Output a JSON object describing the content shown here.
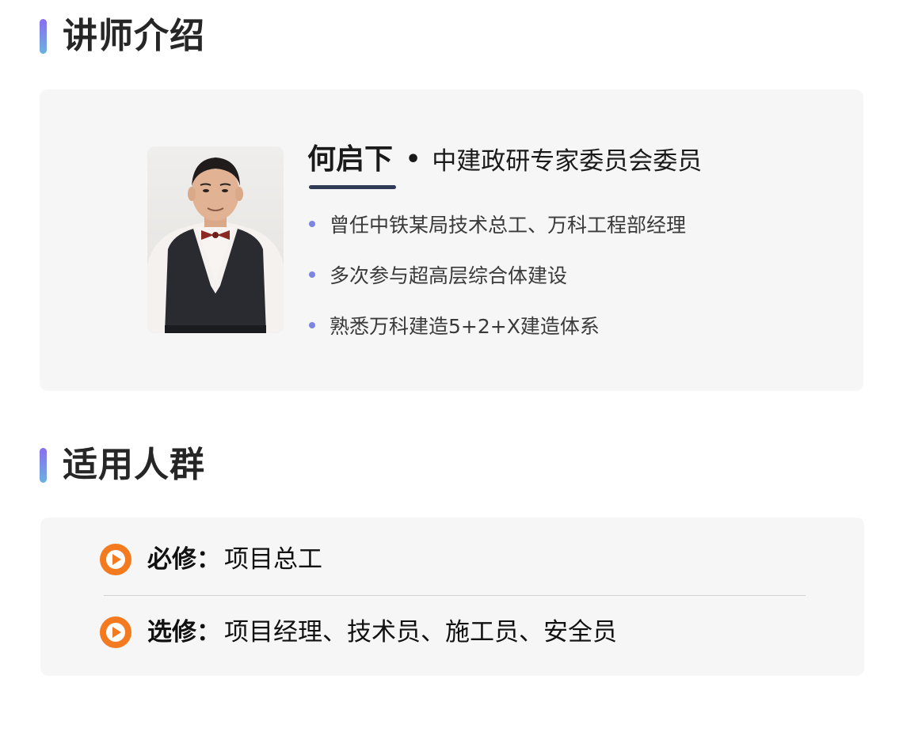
{
  "sections": {
    "instructor_title": "讲师介绍",
    "audience_title": "适用人群"
  },
  "instructor": {
    "name": "何启下",
    "separator": "•",
    "role": "中建政研专家委员会委员",
    "bullets": [
      "曾任中铁某局技术总工、万科工程部经理",
      "多次参与超高层综合体建设",
      "熟悉万科建造5+2+X建造体系"
    ]
  },
  "audience": {
    "required_label": "必修：",
    "required_value": "项目总工",
    "elective_label": "选修：",
    "elective_value": "项目经理、技术员、施工员、安全员"
  },
  "colors": {
    "accent_gradient_start": "#8a6df0",
    "accent_gradient_end": "#6bb2e0",
    "bullet": "#7a86e0",
    "play_icon": "#f47a20",
    "card_bg": "#f6f6f6",
    "underline": "#2f3a55"
  },
  "icons": {
    "audience_row": "play-circle-icon"
  }
}
